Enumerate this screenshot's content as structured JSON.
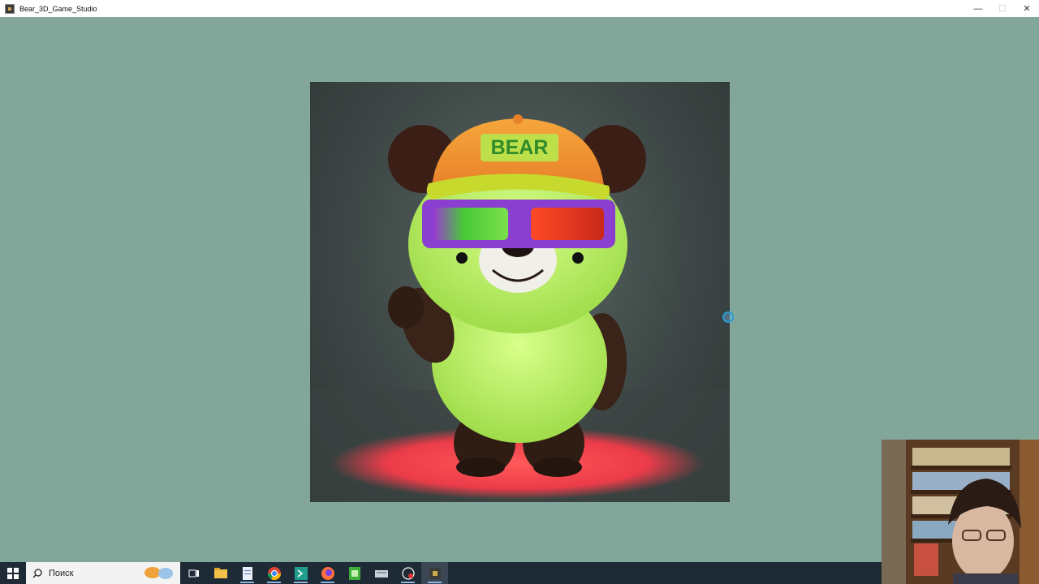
{
  "window": {
    "title": "Bear_3D_Game_Studio",
    "controls": {
      "minimize": "—",
      "maximize": "☐",
      "close": "✕"
    }
  },
  "canvas": {
    "cap_text": "BEAR",
    "colors": {
      "background": "#82a69a",
      "cap": "#f0962e",
      "glasses_frame": "#8a3fd0",
      "lens_left": "#49c83a",
      "lens_right": "#e23a22",
      "floor_spot": "#ff4a4a",
      "fur": "#b9f06a"
    }
  },
  "taskbar": {
    "search_placeholder": "Поиск",
    "icons": [
      "windows-start-icon",
      "search-icon",
      "task-view-icon",
      "file-explorer-icon",
      "notepad-icon",
      "chrome-icon",
      "terminal-icon",
      "firefox-icon",
      "spreadsheet-icon",
      "drive-icon",
      "recorder-icon",
      "bear-studio-icon"
    ]
  }
}
